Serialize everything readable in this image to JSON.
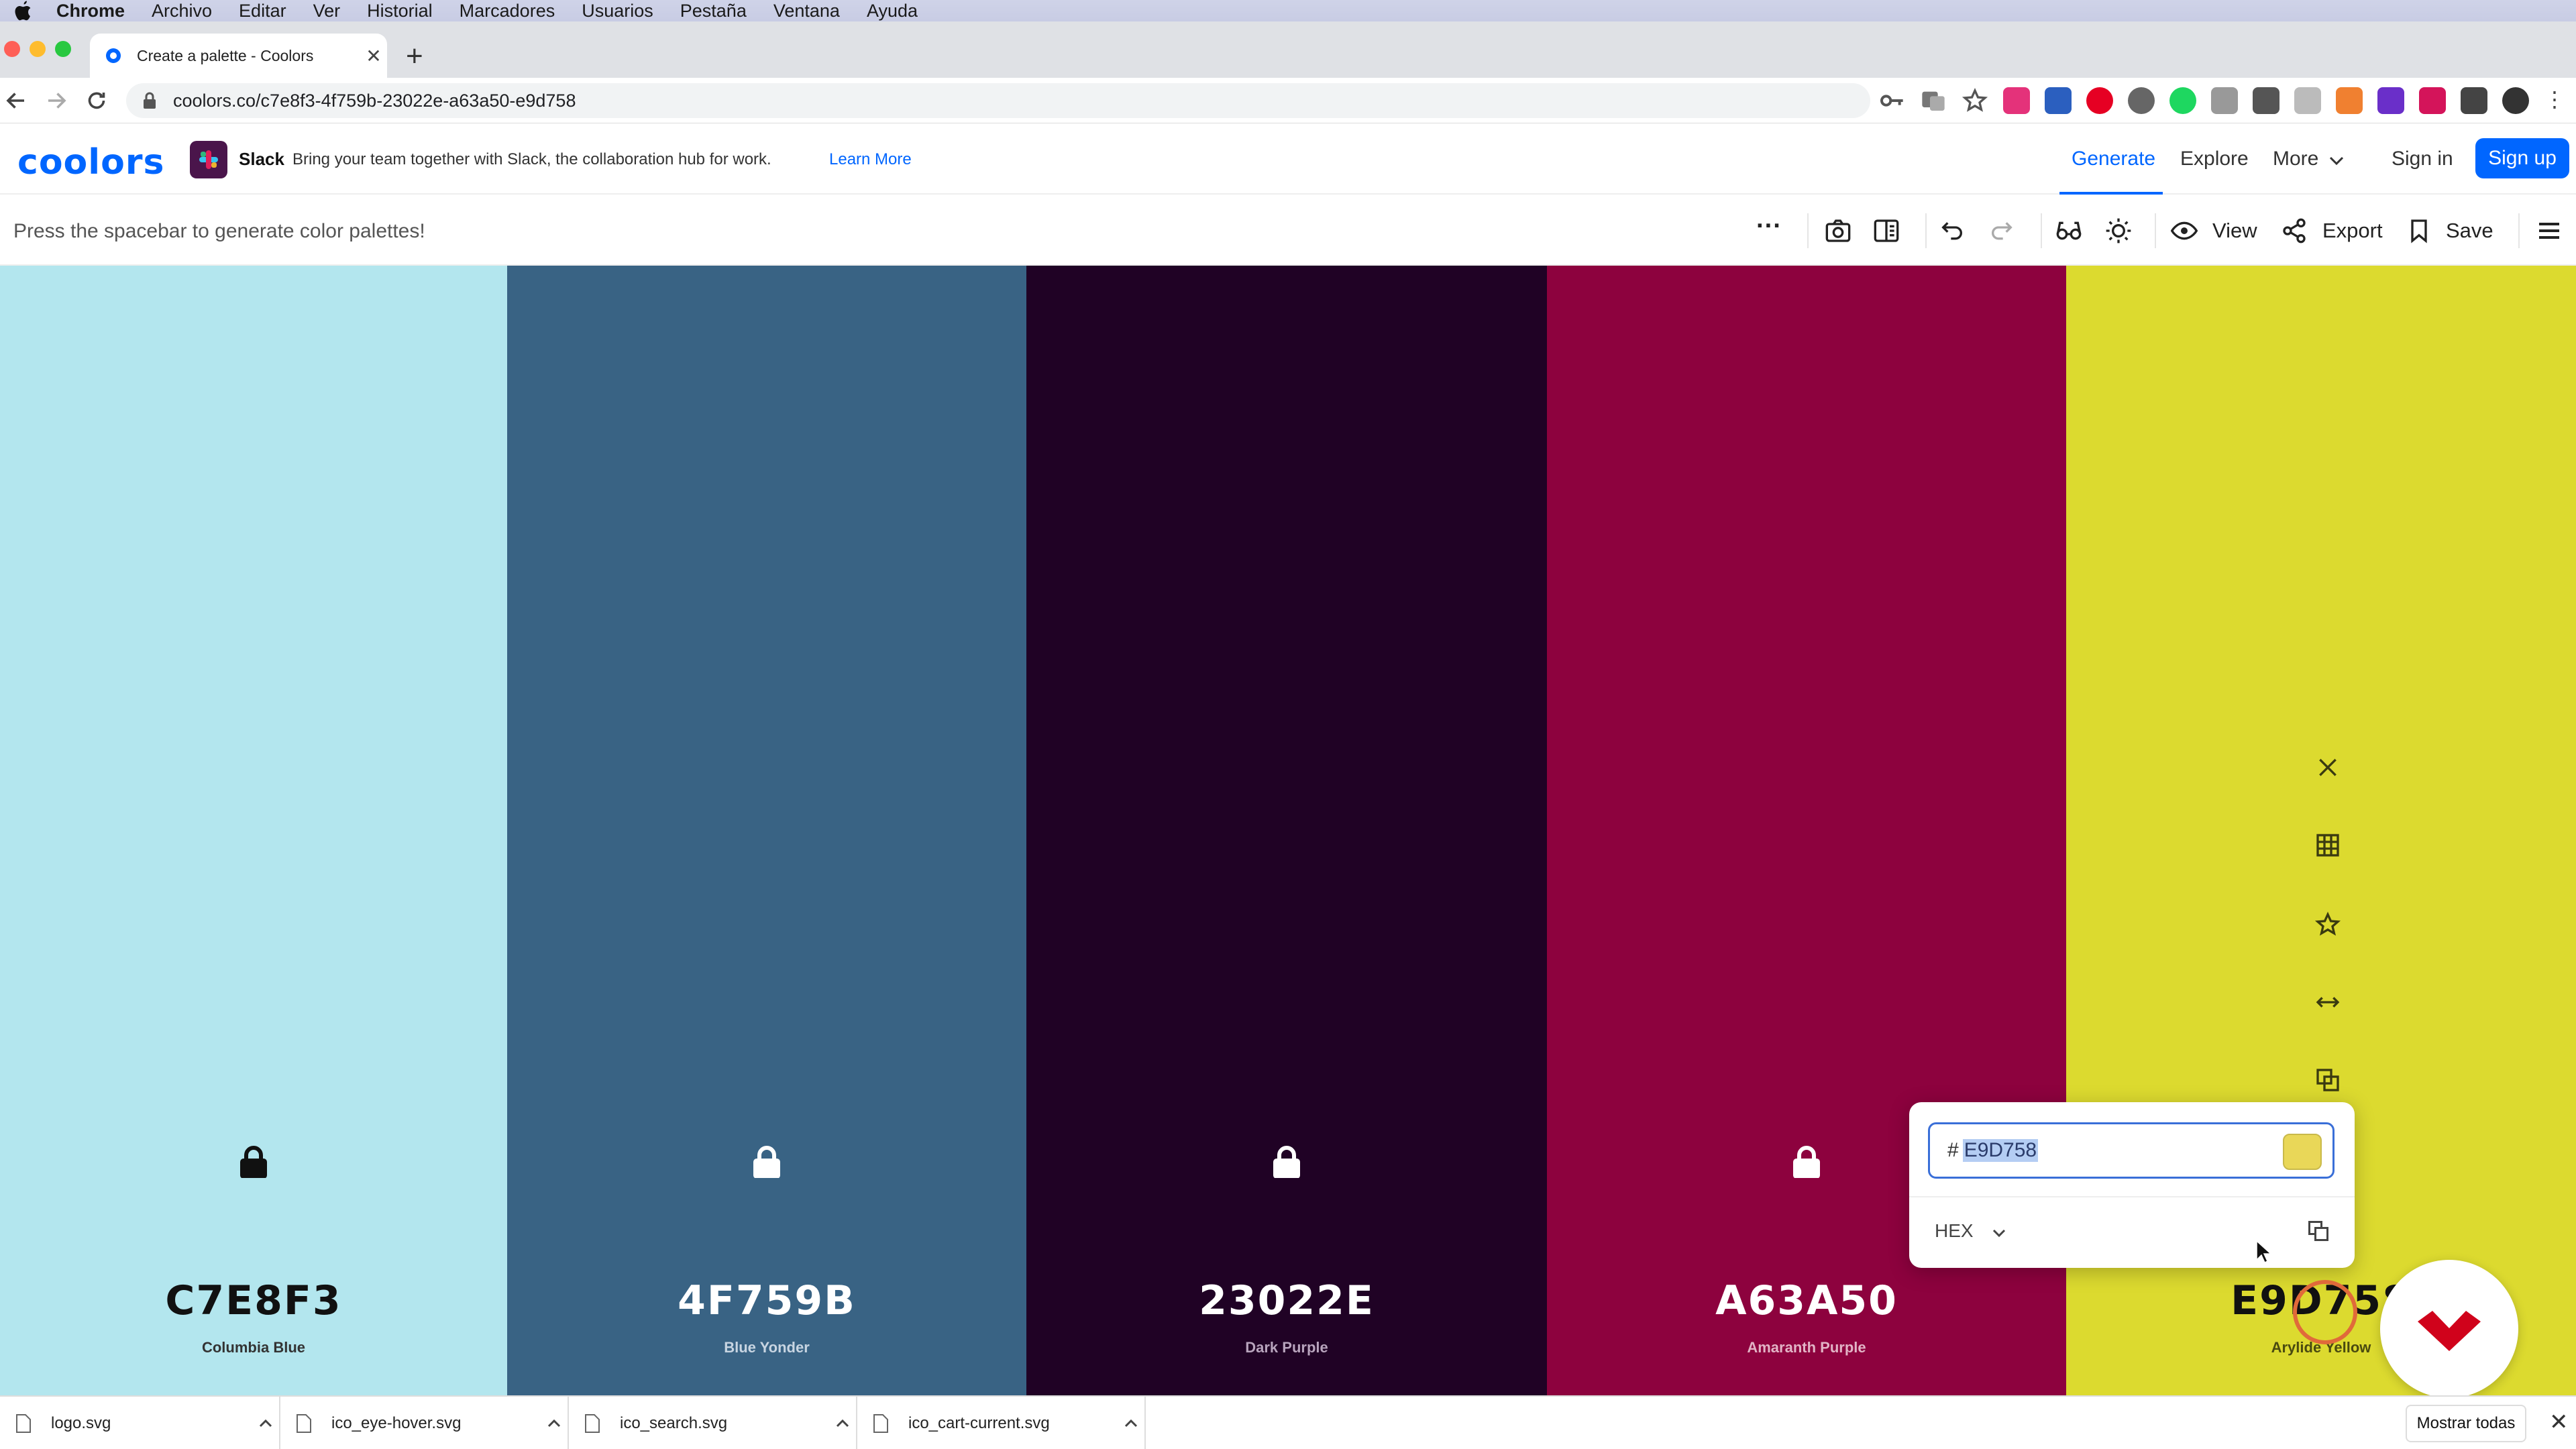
{
  "menubar": {
    "app": "Chrome",
    "items": [
      "Archivo",
      "Editar",
      "Ver",
      "Historial",
      "Marcadores",
      "Usuarios",
      "Pestaña",
      "Ventana",
      "Ayuda"
    ]
  },
  "tab": {
    "title": "Create a palette - Coolors",
    "close": "✕",
    "new_tab": "+"
  },
  "address": {
    "url": "coolors.co/c7e8f3-4f759b-23022e-a63a50-e9d758"
  },
  "header": {
    "logo": "coolors",
    "ad_brand": "Slack",
    "ad_text": "Bring your team together with Slack, the collaboration hub for work.",
    "ad_link": "Learn More",
    "nav": [
      "Generate",
      "Explore",
      "More"
    ],
    "sign_in": "Sign in",
    "sign_up": "Sign up"
  },
  "toolbar": {
    "hint": "Press the spacebar to generate color palettes!",
    "more": "···",
    "view": "View",
    "export": "Export",
    "save": "Save"
  },
  "palette": [
    {
      "hex": "C7E8F3",
      "name": "Columbia Blue",
      "bg": "#b3e6ee",
      "fg": "#111111",
      "name_color": "#333333"
    },
    {
      "hex": "4F759B",
      "name": "Blue Yonder",
      "bg": "#396384",
      "fg": "#ffffff",
      "name_color": "#c8d5e2"
    },
    {
      "hex": "23022E",
      "name": "Dark Purple",
      "bg": "#200225",
      "fg": "#ffffff",
      "name_color": "#b8a4bd"
    },
    {
      "hex": "A63A50",
      "name": "Amaranth Purple",
      "bg": "#8d023e",
      "fg": "#ffffff",
      "name_color": "#e2b4c6"
    },
    {
      "hex": "E9D758",
      "name": "Arylide Yellow",
      "bg": "#dcda2f",
      "fg": "#111111",
      "name_color": "#4a4a10"
    }
  ],
  "picker": {
    "hash": "#",
    "value": "E9D758",
    "mode": "HEX",
    "swatch": "#e9d758"
  },
  "downloads": {
    "files": [
      "logo.svg",
      "ico_eye-hover.svg",
      "ico_search.svg",
      "ico_cart-current.svg"
    ],
    "show_all": "Mostrar todas",
    "close": "✕"
  }
}
